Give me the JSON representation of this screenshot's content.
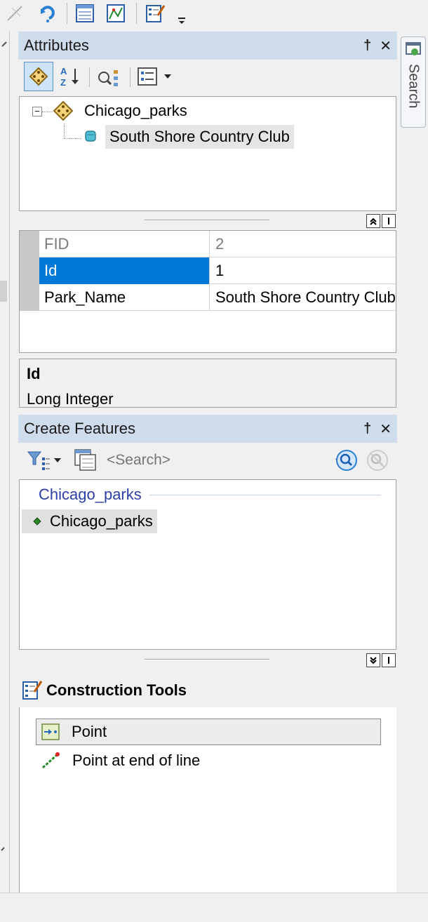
{
  "toolbar": {
    "icons": [
      "edit-line-icon",
      "rotate-icon",
      "attributes-table-icon",
      "sketch-properties-icon",
      "create-features-icon",
      "overflow-chevron-icon"
    ]
  },
  "search_tab": {
    "label": "Search"
  },
  "attributes_panel": {
    "title": "Attributes",
    "pin_glyph": "†",
    "close_glyph": "✕",
    "tree": {
      "layer": "Chicago_parks",
      "feature": "South Shore Country Club",
      "expander": "−"
    },
    "grid": {
      "rows": [
        {
          "name": "FID",
          "value": "2"
        },
        {
          "name": "Id",
          "value": "1"
        },
        {
          "name": "Park_Name",
          "value": "South Shore Country Club"
        }
      ]
    },
    "description": {
      "field": "Id",
      "type": "Long Integer"
    }
  },
  "create_features_panel": {
    "title": "Create Features",
    "pin_glyph": "†",
    "close_glyph": "✕",
    "search_placeholder": "<Search>",
    "group_header": "Chicago_parks",
    "template": "Chicago_parks"
  },
  "construction_tools": {
    "header": "Construction Tools",
    "tools": [
      "Point",
      "Point at end of line"
    ]
  },
  "colors": {
    "title_bar": "#cfdceb",
    "selection": "#0078d7",
    "group_header_text": "#2c3ea8"
  }
}
